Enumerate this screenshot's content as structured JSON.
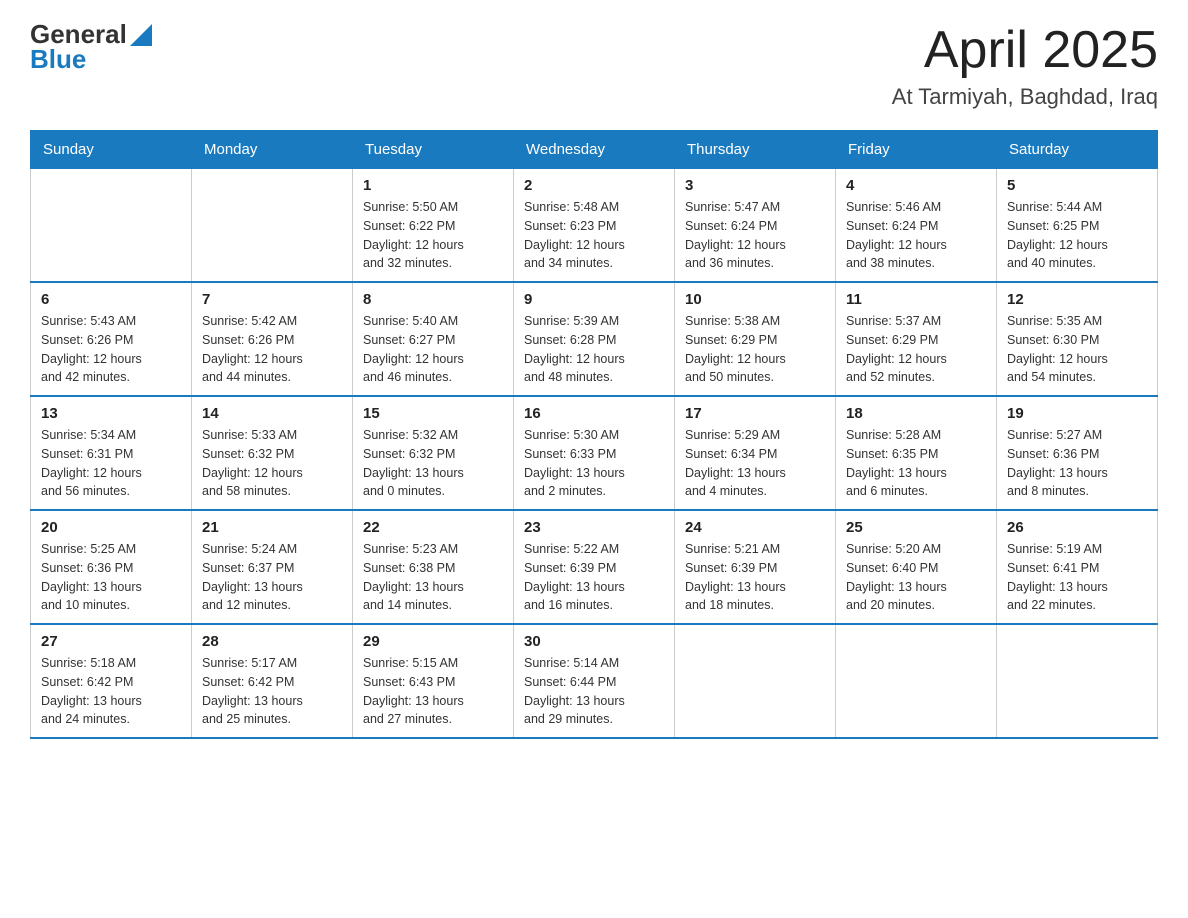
{
  "logo": {
    "text_general": "General",
    "text_blue": "Blue"
  },
  "title": "April 2025",
  "subtitle": "At Tarmiyah, Baghdad, Iraq",
  "days_of_week": [
    "Sunday",
    "Monday",
    "Tuesday",
    "Wednesday",
    "Thursday",
    "Friday",
    "Saturday"
  ],
  "weeks": [
    [
      {
        "day": "",
        "info": ""
      },
      {
        "day": "",
        "info": ""
      },
      {
        "day": "1",
        "info": "Sunrise: 5:50 AM\nSunset: 6:22 PM\nDaylight: 12 hours\nand 32 minutes."
      },
      {
        "day": "2",
        "info": "Sunrise: 5:48 AM\nSunset: 6:23 PM\nDaylight: 12 hours\nand 34 minutes."
      },
      {
        "day": "3",
        "info": "Sunrise: 5:47 AM\nSunset: 6:24 PM\nDaylight: 12 hours\nand 36 minutes."
      },
      {
        "day": "4",
        "info": "Sunrise: 5:46 AM\nSunset: 6:24 PM\nDaylight: 12 hours\nand 38 minutes."
      },
      {
        "day": "5",
        "info": "Sunrise: 5:44 AM\nSunset: 6:25 PM\nDaylight: 12 hours\nand 40 minutes."
      }
    ],
    [
      {
        "day": "6",
        "info": "Sunrise: 5:43 AM\nSunset: 6:26 PM\nDaylight: 12 hours\nand 42 minutes."
      },
      {
        "day": "7",
        "info": "Sunrise: 5:42 AM\nSunset: 6:26 PM\nDaylight: 12 hours\nand 44 minutes."
      },
      {
        "day": "8",
        "info": "Sunrise: 5:40 AM\nSunset: 6:27 PM\nDaylight: 12 hours\nand 46 minutes."
      },
      {
        "day": "9",
        "info": "Sunrise: 5:39 AM\nSunset: 6:28 PM\nDaylight: 12 hours\nand 48 minutes."
      },
      {
        "day": "10",
        "info": "Sunrise: 5:38 AM\nSunset: 6:29 PM\nDaylight: 12 hours\nand 50 minutes."
      },
      {
        "day": "11",
        "info": "Sunrise: 5:37 AM\nSunset: 6:29 PM\nDaylight: 12 hours\nand 52 minutes."
      },
      {
        "day": "12",
        "info": "Sunrise: 5:35 AM\nSunset: 6:30 PM\nDaylight: 12 hours\nand 54 minutes."
      }
    ],
    [
      {
        "day": "13",
        "info": "Sunrise: 5:34 AM\nSunset: 6:31 PM\nDaylight: 12 hours\nand 56 minutes."
      },
      {
        "day": "14",
        "info": "Sunrise: 5:33 AM\nSunset: 6:32 PM\nDaylight: 12 hours\nand 58 minutes."
      },
      {
        "day": "15",
        "info": "Sunrise: 5:32 AM\nSunset: 6:32 PM\nDaylight: 13 hours\nand 0 minutes."
      },
      {
        "day": "16",
        "info": "Sunrise: 5:30 AM\nSunset: 6:33 PM\nDaylight: 13 hours\nand 2 minutes."
      },
      {
        "day": "17",
        "info": "Sunrise: 5:29 AM\nSunset: 6:34 PM\nDaylight: 13 hours\nand 4 minutes."
      },
      {
        "day": "18",
        "info": "Sunrise: 5:28 AM\nSunset: 6:35 PM\nDaylight: 13 hours\nand 6 minutes."
      },
      {
        "day": "19",
        "info": "Sunrise: 5:27 AM\nSunset: 6:36 PM\nDaylight: 13 hours\nand 8 minutes."
      }
    ],
    [
      {
        "day": "20",
        "info": "Sunrise: 5:25 AM\nSunset: 6:36 PM\nDaylight: 13 hours\nand 10 minutes."
      },
      {
        "day": "21",
        "info": "Sunrise: 5:24 AM\nSunset: 6:37 PM\nDaylight: 13 hours\nand 12 minutes."
      },
      {
        "day": "22",
        "info": "Sunrise: 5:23 AM\nSunset: 6:38 PM\nDaylight: 13 hours\nand 14 minutes."
      },
      {
        "day": "23",
        "info": "Sunrise: 5:22 AM\nSunset: 6:39 PM\nDaylight: 13 hours\nand 16 minutes."
      },
      {
        "day": "24",
        "info": "Sunrise: 5:21 AM\nSunset: 6:39 PM\nDaylight: 13 hours\nand 18 minutes."
      },
      {
        "day": "25",
        "info": "Sunrise: 5:20 AM\nSunset: 6:40 PM\nDaylight: 13 hours\nand 20 minutes."
      },
      {
        "day": "26",
        "info": "Sunrise: 5:19 AM\nSunset: 6:41 PM\nDaylight: 13 hours\nand 22 minutes."
      }
    ],
    [
      {
        "day": "27",
        "info": "Sunrise: 5:18 AM\nSunset: 6:42 PM\nDaylight: 13 hours\nand 24 minutes."
      },
      {
        "day": "28",
        "info": "Sunrise: 5:17 AM\nSunset: 6:42 PM\nDaylight: 13 hours\nand 25 minutes."
      },
      {
        "day": "29",
        "info": "Sunrise: 5:15 AM\nSunset: 6:43 PM\nDaylight: 13 hours\nand 27 minutes."
      },
      {
        "day": "30",
        "info": "Sunrise: 5:14 AM\nSunset: 6:44 PM\nDaylight: 13 hours\nand 29 minutes."
      },
      {
        "day": "",
        "info": ""
      },
      {
        "day": "",
        "info": ""
      },
      {
        "day": "",
        "info": ""
      }
    ]
  ]
}
